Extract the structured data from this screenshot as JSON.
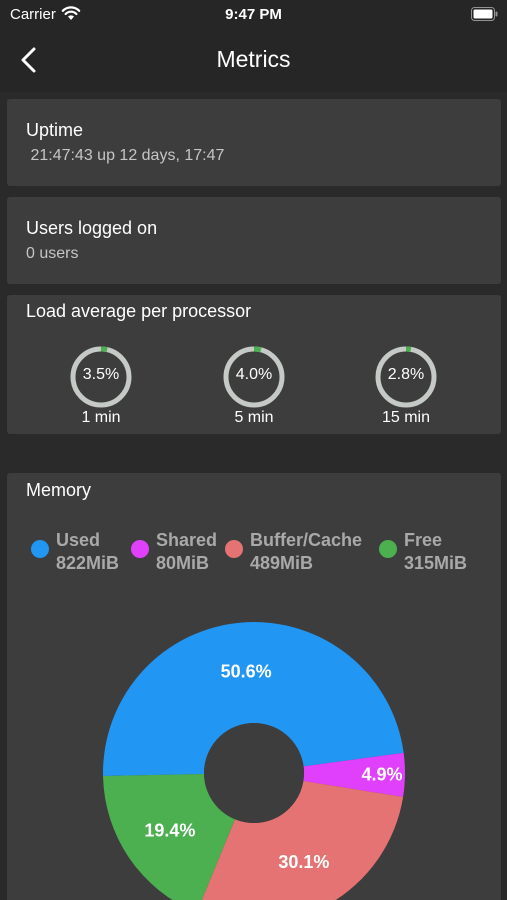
{
  "status_bar": {
    "carrier": "Carrier",
    "time": "9:47 PM"
  },
  "nav": {
    "title": "Metrics",
    "back_icon": "chevron-left-icon"
  },
  "uptime": {
    "title": "Uptime",
    "value": " 21:47:43 up 12 days, 17:47"
  },
  "users": {
    "title": "Users logged on",
    "value": "0 users"
  },
  "load": {
    "title": "Load average per processor",
    "gauges": [
      {
        "value": "3.5%",
        "fraction": 0.035,
        "label": "1 min"
      },
      {
        "value": "4.0%",
        "fraction": 0.04,
        "label": "5 min"
      },
      {
        "value": "2.8%",
        "fraction": 0.028,
        "label": "15 min"
      }
    ]
  },
  "memory": {
    "title": "Memory",
    "legend": [
      {
        "name": "Used",
        "value": "822MiB",
        "color": "#2196f3"
      },
      {
        "name": "Shared",
        "value": "80MiB",
        "color": "#e040fb"
      },
      {
        "name": "Buffer/Cache",
        "value": "489MiB",
        "color": "#e57373"
      },
      {
        "name": "Free",
        "value": "315MiB",
        "color": "#4caf50"
      }
    ]
  },
  "chart_data": {
    "type": "pie",
    "title": "Memory",
    "categories": [
      "Used",
      "Shared",
      "Buffer/Cache",
      "Free"
    ],
    "values": [
      50.6,
      4.9,
      30.1,
      19.4
    ],
    "labels": [
      "50.6%",
      "4.9%",
      "30.1%",
      "19.4%"
    ],
    "colors": [
      "#2196f3",
      "#e040fb",
      "#e57373",
      "#4caf50"
    ],
    "donut": true
  }
}
